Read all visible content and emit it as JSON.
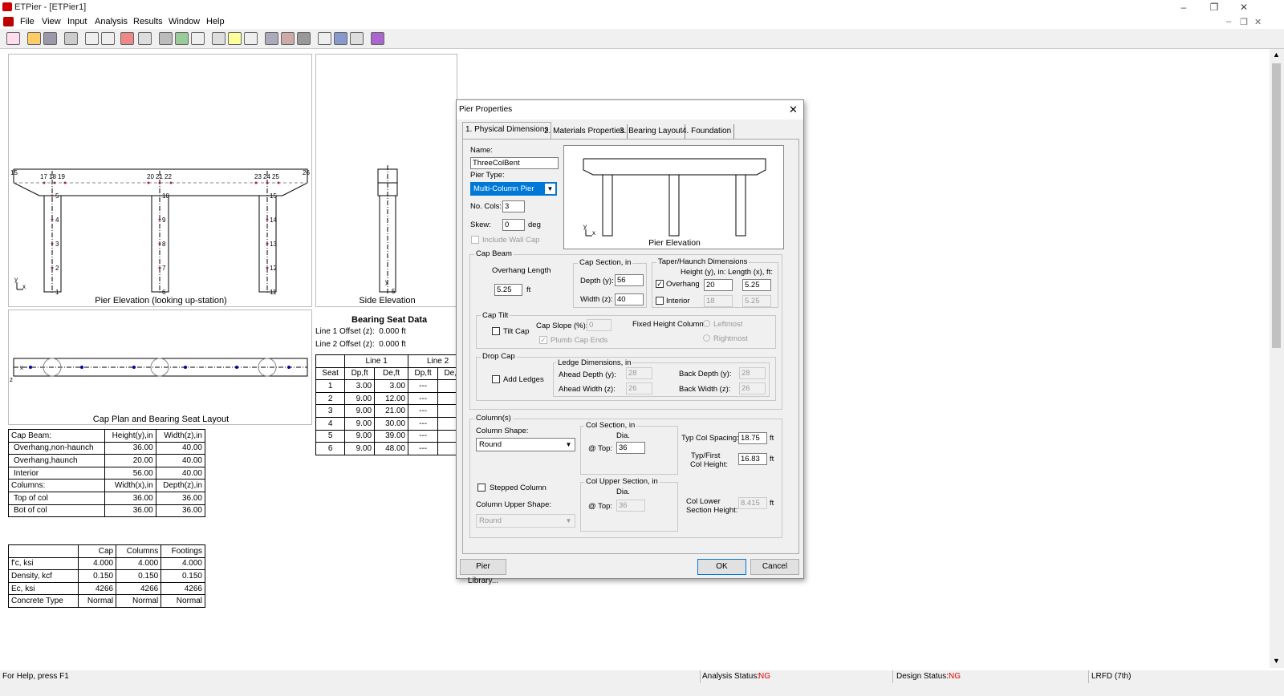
{
  "window": {
    "title": "ETPier - [ETPier1]",
    "minimize": "–",
    "restore": "❐",
    "close": "✕",
    "child_min": "–",
    "child_restore": "❐",
    "child_close": "✕"
  },
  "menu": [
    "File",
    "View",
    "Input",
    "Analysis",
    "Results",
    "Window",
    "Help"
  ],
  "pier_elevation": {
    "caption": "Pier Elevation (looking up-station)",
    "nodes_top": [
      "15",
      "17",
      "18",
      "19",
      "20",
      "21",
      "22",
      "23",
      "24",
      "25",
      "26"
    ],
    "col1_nodes": [
      "5",
      "4",
      "3",
      "2",
      "1"
    ],
    "col2_nodes": [
      "10",
      "9",
      "8",
      "7",
      "6"
    ],
    "col3_nodes": [
      "15",
      "14",
      "13",
      "12",
      "11"
    ],
    "axis_y": "y",
    "axis_x": "x"
  },
  "side_elevation": {
    "caption": "Side Elevation",
    "node_top": "5",
    "node_bot": "5",
    "axis": "y"
  },
  "cap_plan": {
    "caption": "Cap Plan and Bearing Seat Layout",
    "axis_z": "z",
    "axis_x": "x"
  },
  "bearing_seat": {
    "title": "Bearing Seat Data",
    "line1_offset": "Line 1 Offset (z):  0.000 ft",
    "line2_offset": "Line 2 Offset (z):  0.000 ft",
    "headers": [
      "Line 1",
      "Line 2"
    ],
    "subheaders": [
      "Seat",
      "Dp,ft",
      "De,ft",
      "Dp,ft",
      "De,ft"
    ],
    "rows": [
      [
        "1",
        "3.00",
        "3.00",
        "---",
        "---"
      ],
      [
        "2",
        "9.00",
        "12.00",
        "---",
        "---"
      ],
      [
        "3",
        "9.00",
        "21.00",
        "---",
        "---"
      ],
      [
        "4",
        "9.00",
        "30.00",
        "---",
        "---"
      ],
      [
        "5",
        "9.00",
        "39.00",
        "---",
        "---"
      ],
      [
        "6",
        "9.00",
        "48.00",
        "---",
        "---"
      ]
    ]
  },
  "dims_table": {
    "rows": [
      [
        "Cap Beam:",
        "Height(y),in",
        "Width(z),in"
      ],
      [
        "Overhang,non-haunch",
        "36.00",
        "40.00"
      ],
      [
        "Overhang,haunch",
        "20.00",
        "40.00"
      ],
      [
        "Interior",
        "56.00",
        "40.00"
      ],
      [
        "Columns:",
        "Width(x),in",
        "Depth(z),in"
      ],
      [
        "Top of col",
        "36.00",
        "36.00"
      ],
      [
        "Bot of col",
        "36.00",
        "36.00"
      ]
    ]
  },
  "mat_table": {
    "rows": [
      [
        "",
        "Cap",
        "Columns",
        "Footings"
      ],
      [
        "f'c, ksi",
        "4.000",
        "4.000",
        "4.000"
      ],
      [
        "Density, kcf",
        "0.150",
        "0.150",
        "0.150"
      ],
      [
        "Ec, ksi",
        "4266",
        "4266",
        "4266"
      ],
      [
        "Concrete Type",
        "Normal",
        "Normal",
        "Normal"
      ]
    ]
  },
  "dialog": {
    "title": "Pier Properties",
    "close": "✕",
    "tabs": [
      "1. Physical Dimensions",
      "2. Materials Properties",
      "3. Bearing Layout",
      "4. Foundation"
    ],
    "name_label": "Name:",
    "name_value": "ThreeColBent",
    "pier_type_label": "Pier Type:",
    "pier_type_value": "Multi-Column Pier",
    "no_cols_label": "No. Cols:",
    "no_cols_value": "3",
    "skew_label": "Skew:",
    "skew_value": "0",
    "skew_unit": "deg",
    "include_wall_cap": "Include Wall Cap",
    "preview_caption": "Pier Elevation",
    "preview_y": "y",
    "preview_x": "x",
    "cap_beam": {
      "title": "Cap Beam",
      "overhang_length_label": "Overhang Length",
      "overhang_length_value": "5.25",
      "overhang_unit": "ft",
      "cap_section_title": "Cap Section, in",
      "depth_label": "Depth (y):",
      "depth_value": "56",
      "width_label": "Width (z):",
      "width_value": "40",
      "taper_title": "Taper/Haunch Dimensions",
      "height_hdr": "Height (y), in:",
      "length_hdr": "Length (x), ft:",
      "overhang_label": "Overhang",
      "overhang_h": "20",
      "overhang_l": "5.25",
      "overhang_checked": "✓",
      "interior_label": "Interior",
      "interior_h": "18",
      "interior_l": "5.25"
    },
    "cap_tilt": {
      "title": "Cap Tilt",
      "tilt_cap": "Tilt Cap",
      "cap_slope_label": "Cap Slope (%):",
      "cap_slope_value": "0",
      "plumb": "Plumb Cap Ends",
      "plumb_checked": "✓",
      "fixed_height_label": "Fixed Height Column:",
      "leftmost": "Leftmost",
      "rightmost": "Rightmost"
    },
    "drop_cap": {
      "title": "Drop Cap",
      "add_ledges": "Add Ledges",
      "ledge_title": "Ledge Dimensions, in",
      "ahead_depth_label": "Ahead Depth (y):",
      "ahead_depth": "28",
      "ahead_width_label": "Ahead Width (z):",
      "ahead_width": "26",
      "back_depth_label": "Back Depth (y):",
      "back_depth": "28",
      "back_width_label": "Back Width (z):",
      "back_width": "26"
    },
    "columns": {
      "title": "Column(s)",
      "shape_label": "Column Shape:",
      "shape_value": "Round",
      "col_section_title": "Col Section, in",
      "dia_label": "Dia.",
      "top_label": "@ Top:",
      "top_value": "36",
      "spacing_label": "Typ Col Spacing:",
      "spacing_value": "18.75",
      "spacing_unit": "ft",
      "height_label1": "Typ/First",
      "height_label2": "Col Height:",
      "height_value": "16.83",
      "height_unit": "ft",
      "stepped": "Stepped Column",
      "upper_shape_label": "Column Upper Shape:",
      "upper_shape_value": "Round",
      "upper_section_title": "Col Upper Section, in",
      "upper_dia": "Dia.",
      "upper_top_label": "@ Top:",
      "upper_top_value": "36",
      "lower_label1": "Col Lower",
      "lower_label2": "Section Height:",
      "lower_value": "8.415",
      "lower_unit": "ft"
    },
    "buttons": {
      "library": "Pier Library...",
      "ok": "OK",
      "cancel": "Cancel"
    }
  },
  "status": {
    "help": "For Help, press F1",
    "analysis_label": "Analysis Status:",
    "analysis_value": "NG",
    "design_label": "Design Status:",
    "design_value": "NG",
    "code": "LRFD (7th)",
    "ng_color": "#e00000"
  }
}
